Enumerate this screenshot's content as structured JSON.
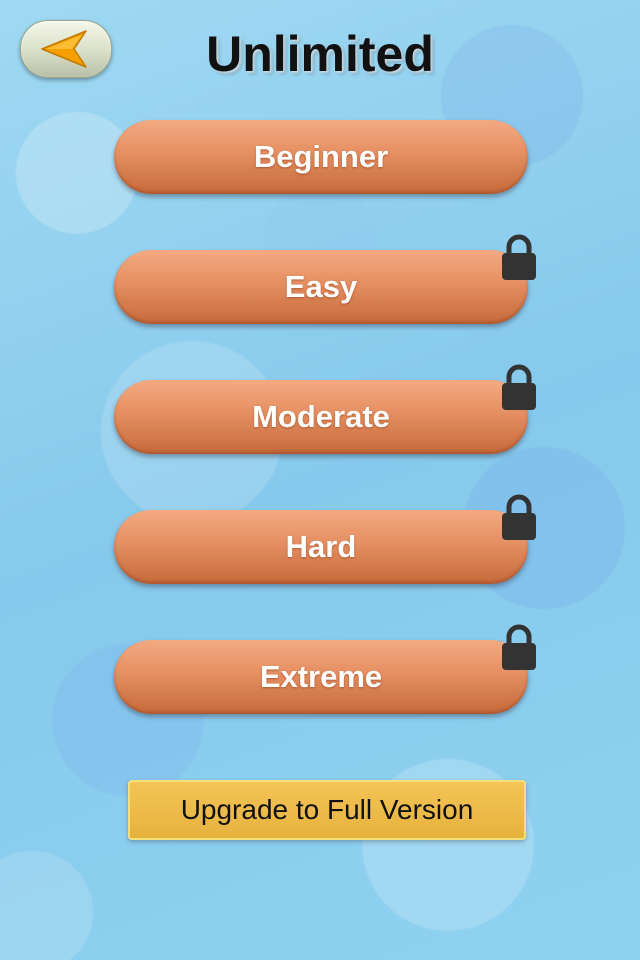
{
  "header": {
    "title": "Unlimited",
    "back_icon": "back-arrow-icon"
  },
  "levels": [
    {
      "label": "Beginner",
      "locked": false
    },
    {
      "label": "Easy",
      "locked": true
    },
    {
      "label": "Moderate",
      "locked": true
    },
    {
      "label": "Hard",
      "locked": true
    },
    {
      "label": "Extreme",
      "locked": true
    }
  ],
  "upgrade": {
    "label": "Upgrade to Full Version"
  },
  "colors": {
    "background": "#8fd0ee",
    "level_button": "#e58f62",
    "upgrade_button": "#e6b23e",
    "back_arrow": "#f5a000",
    "lock": "#333333"
  }
}
